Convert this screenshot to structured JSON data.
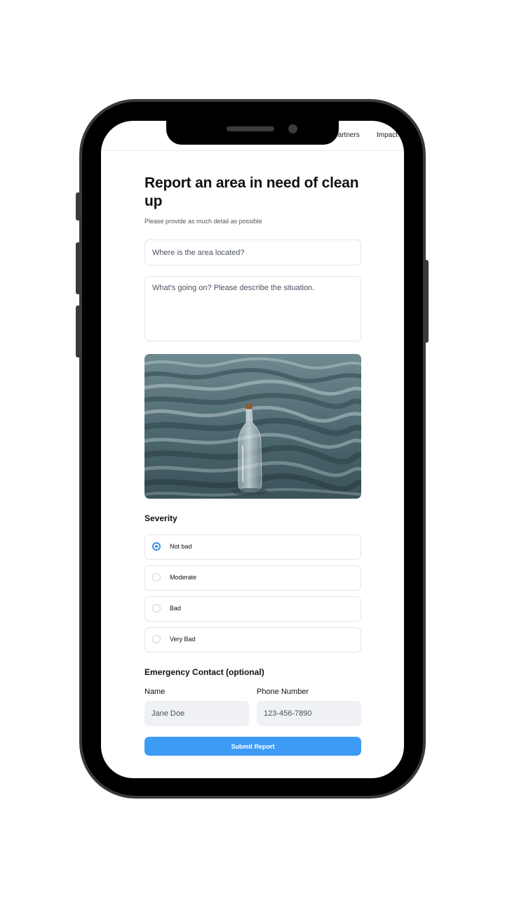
{
  "nav": {
    "links": [
      "Partners",
      "Impact"
    ]
  },
  "form": {
    "title": "Report an area in need of clean up",
    "subtitle": "Please provide as much detail as possible",
    "location_placeholder": "Where is the area located?",
    "description_placeholder": "What's going on? Please describe the situation.",
    "photo_icon": "bottle-in-water-photo",
    "severity": {
      "label": "Severity",
      "options": [
        "Not bad",
        "Moderate",
        "Bad",
        "Very Bad"
      ],
      "selected": "Not bad"
    },
    "emergency_contact": {
      "label": "Emergency Contact (optional)",
      "name_label": "Name",
      "name_placeholder": "Jane Doe",
      "phone_label": "Phone Number",
      "phone_placeholder": "123-456-7890"
    },
    "submit_label": "Submit Report"
  },
  "colors": {
    "accent": "#3d9bf5",
    "radio_selected": "#3d8fe3",
    "field_border": "#e2e5ea",
    "filled_field_bg": "#eff1f5"
  }
}
